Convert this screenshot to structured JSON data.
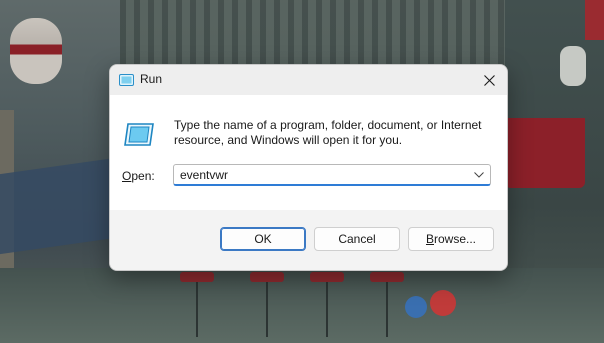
{
  "window": {
    "title": "Run",
    "icon": "run-icon",
    "close_icon": "close-icon"
  },
  "body": {
    "description_line1": "Type the name of a program, folder, document, or Internet",
    "description_line2": "resource, and Windows will open it for you.",
    "open_label_mnemonic": "O",
    "open_label_rest": "pen:",
    "open_value": "eventvwr",
    "dropdown_icon": "chevron-down-icon"
  },
  "buttons": {
    "ok": "OK",
    "cancel": "Cancel",
    "browse_mnemonic": "B",
    "browse_rest": "rowse..."
  },
  "colors": {
    "accent": "#2e7cd6",
    "dialog_bg": "#f3f3f3",
    "content_bg": "#ffffff"
  }
}
